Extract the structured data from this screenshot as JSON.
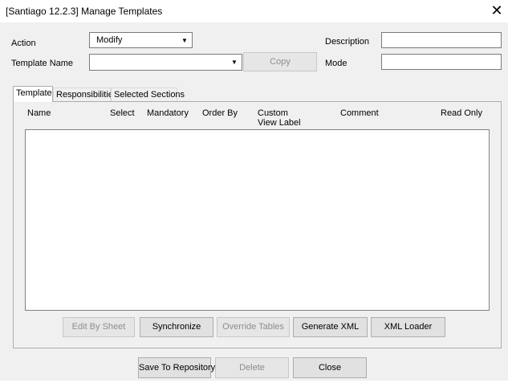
{
  "window": {
    "title": "[Santiago 12.2.3] Manage Templates",
    "close_glyph": "✕"
  },
  "form": {
    "action_label": "Action",
    "action_value": "Modify",
    "template_name_label": "Template Name",
    "template_name_value": "",
    "copy_button": "Copy",
    "description_label": "Description",
    "description_value": "",
    "mode_label": "Mode",
    "mode_value": ""
  },
  "tabs": [
    {
      "label": "Template",
      "active": true
    },
    {
      "label": "Responsibilities",
      "active": false
    },
    {
      "label": "Selected Sections",
      "active": false
    }
  ],
  "grid": {
    "columns": [
      "Name",
      "Select",
      "Mandatory",
      "Order By",
      "Custom\nView Label",
      "Comment",
      "Read Only"
    ],
    "rows": []
  },
  "panel_buttons": {
    "edit_by_sheet": "Edit By Sheet",
    "synchronize": "Synchronize",
    "override_tables": "Override Tables",
    "generate_xml": "Generate XML",
    "xml_loader": "XML Loader"
  },
  "footer_buttons": {
    "save_to_repository": "Save To Repository",
    "delete": "Delete",
    "close": "Close"
  },
  "icons": {
    "dropdown": "chevron-down-icon",
    "close": "close-icon"
  }
}
